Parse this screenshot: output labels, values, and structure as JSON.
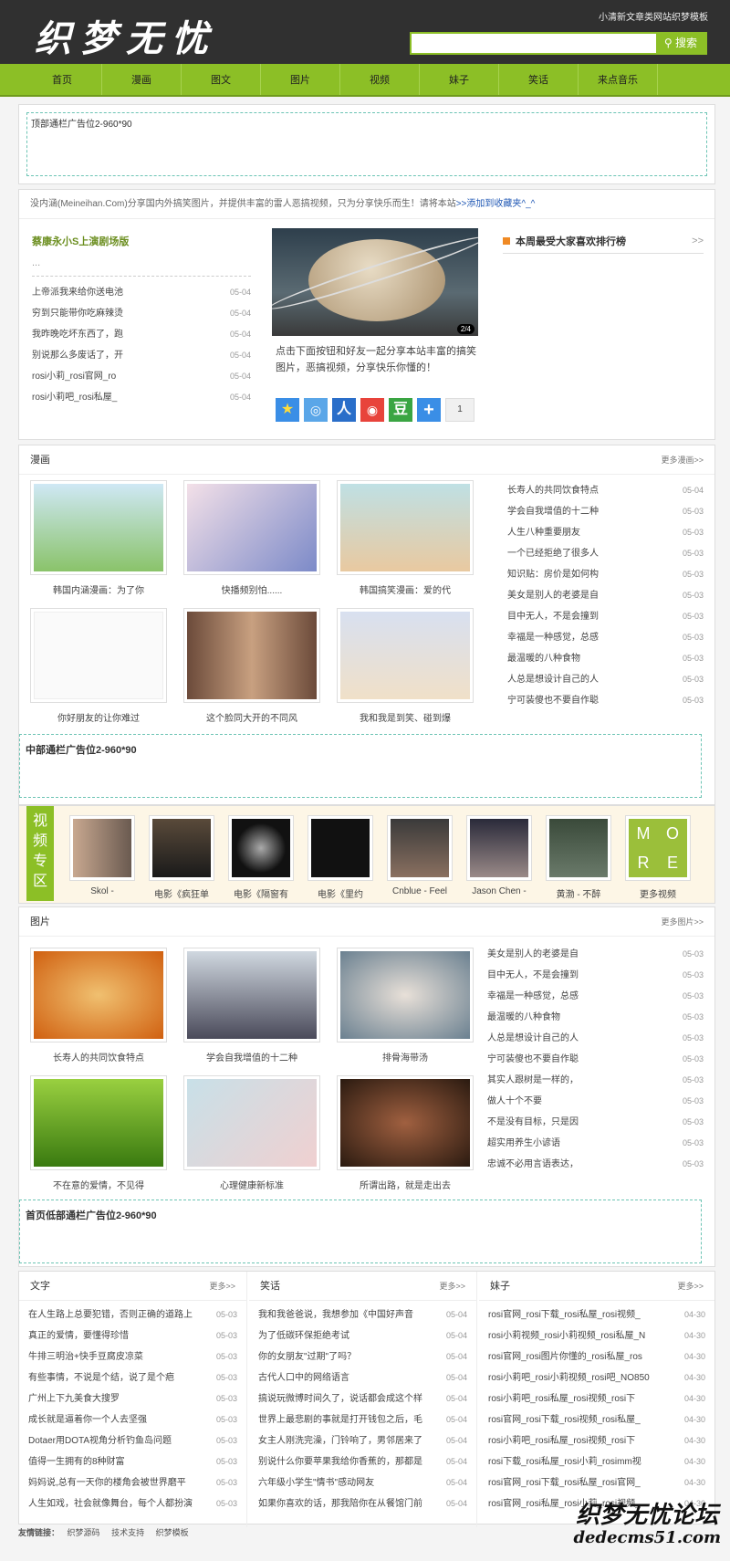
{
  "header": {
    "logo": "织梦无忧",
    "toplink": "小清新文章类网站织梦模板",
    "search_placeholder": "",
    "search_btn": "搜索"
  },
  "nav": [
    "首页",
    "漫画",
    "图文",
    "图片",
    "视频",
    "妹子",
    "笑话",
    "来点音乐"
  ],
  "ads": {
    "top": "顶部通栏广告位2-960*90",
    "middle": "中部通栏广告位2-960*90",
    "bottom": "首页低部通栏广告位2-960*90"
  },
  "notice": {
    "text": "没内涵(Meineihan.Com)分享国内外搞笑图片，并提供丰富的雷人恶搞视频，只为分享快乐而生！请将本站",
    "link": ">>添加到收藏夹^_^"
  },
  "headline": {
    "title": "蔡康永小S上演剧场版",
    "sub": "...",
    "items": [
      {
        "t": "上帝派我来给你送电池",
        "d": "05-04"
      },
      {
        "t": "穷到只能带你吃麻辣烫",
        "d": "05-04"
      },
      {
        "t": "我昨晚吃坏东西了，跑",
        "d": "05-04"
      },
      {
        "t": "别说那么多废话了，开",
        "d": "05-04"
      },
      {
        "t": "rosi小莉_rosi官网_ro",
        "d": "05-04"
      },
      {
        "t": "rosi小莉吧_rosi私屋_",
        "d": "05-04"
      }
    ]
  },
  "slider": {
    "counter": "2/4",
    "text": "点击下面按钮和好友一起分享本站丰富的搞笑图片，恶搞视频，分享快乐你懂的！",
    "share_count": "1"
  },
  "rank": {
    "title": "本周最受大家喜欢排行榜",
    "more": ">>"
  },
  "comics": {
    "title": "漫画",
    "more": "更多漫画>>",
    "thumbs": [
      "韩国内涵漫画：为了你",
      "快播频别怕......",
      "韩国搞笑漫画：爱的代",
      "你好朋友的让你难过",
      "这个脸同大开的不同风",
      "我和我是到笑、碰到爆"
    ],
    "list": [
      {
        "t": "长寿人的共同饮食特点",
        "d": "05-04"
      },
      {
        "t": "学会自我增值的十二种",
        "d": "05-03"
      },
      {
        "t": "人生八种重要朋友",
        "d": "05-03"
      },
      {
        "t": "一个已经拒绝了很多人",
        "d": "05-03"
      },
      {
        "t": "知识贴：房价是如何构",
        "d": "05-03"
      },
      {
        "t": "美女是别人的老婆是自",
        "d": "05-03"
      },
      {
        "t": "目中无人，不是会撞到",
        "d": "05-03"
      },
      {
        "t": "幸福是一种感觉，总感",
        "d": "05-03"
      },
      {
        "t": "最温暖的八种食物",
        "d": "05-03"
      },
      {
        "t": "人总是想设计自己的人",
        "d": "05-03"
      },
      {
        "t": "宁可装傻也不要自作聪",
        "d": "05-03"
      }
    ]
  },
  "video": {
    "label": "视频专区",
    "thumbs": [
      "Skol -",
      "电影《疯狂单",
      "电影《隔窗有",
      "电影《里约",
      "Cnblue - Feel",
      "Jason Chen -",
      "黄渤 - 不醉",
      "更多视频"
    ],
    "more_tile": [
      "M",
      "O",
      "R",
      "E"
    ]
  },
  "pics": {
    "title": "图片",
    "more": "更多图片>>",
    "thumbs": [
      "长寿人的共同饮食特点",
      "学会自我增值的十二种",
      "排骨海带汤",
      "不在意的爱情，不见得",
      "心理健康新标准",
      "所谓出路，就是走出去"
    ],
    "list": [
      {
        "t": "美女是别人的老婆是自",
        "d": "05-03"
      },
      {
        "t": "目中无人，不是会撞到",
        "d": "05-03"
      },
      {
        "t": "幸福是一种感觉，总感",
        "d": "05-03"
      },
      {
        "t": "最温暖的八种食物",
        "d": "05-03"
      },
      {
        "t": "人总是想设计自己的人",
        "d": "05-03"
      },
      {
        "t": "宁可装傻也不要自作聪",
        "d": "05-03"
      },
      {
        "t": "其实人跟树是一样的，",
        "d": "05-03"
      },
      {
        "t": "做人十个不要",
        "d": "05-03"
      },
      {
        "t": "不是没有目标，只是因",
        "d": "05-03"
      },
      {
        "t": "超实用养生小谚语",
        "d": "05-03"
      },
      {
        "t": "忠诚不必用言语表达，",
        "d": "05-03"
      }
    ]
  },
  "cols": [
    {
      "title": "文字",
      "more": "更多>>",
      "items": [
        {
          "t": "在人生路上总要犯错，否则正确的道路上",
          "d": "05-03"
        },
        {
          "t": "真正的爱情，要懂得珍惜",
          "d": "05-03"
        },
        {
          "t": "牛排三明治+快手豆腐皮凉菜",
          "d": "05-03"
        },
        {
          "t": "有些事情，不说是个结，说了是个疤",
          "d": "05-03"
        },
        {
          "t": "广州上下九美食大搜罗",
          "d": "05-03"
        },
        {
          "t": "成长就是逼着你一个人去坚强",
          "d": "05-03"
        },
        {
          "t": "Dotaer用DOTA视角分析钓鱼岛问题",
          "d": "05-03"
        },
        {
          "t": "值得一生拥有的8种财富",
          "d": "05-03"
        },
        {
          "t": "妈妈说,总有一天你的楼角会被世界磨平",
          "d": "05-03"
        },
        {
          "t": "人生如戏，社会就像舞台，每个人都扮演",
          "d": "05-03"
        }
      ]
    },
    {
      "title": "笑话",
      "more": "更多>>",
      "items": [
        {
          "t": "我和我爸爸说，我想参加《中国好声音",
          "d": "05-04"
        },
        {
          "t": "为了低碳环保拒绝考试",
          "d": "05-04"
        },
        {
          "t": "你的女朋友\"过期\"了吗？",
          "d": "05-04"
        },
        {
          "t": "古代人口中的网络语言",
          "d": "05-04"
        },
        {
          "t": "搞说玩微博时间久了，说话都会成这个样",
          "d": "05-04"
        },
        {
          "t": "世界上最悲剧的事就是打开钱包之后，毛",
          "d": "05-04"
        },
        {
          "t": "女主人刚洗完澡，门铃响了，男邻居来了",
          "d": "05-04"
        },
        {
          "t": "别说什么你要苹果我给你香蕉的，那都是",
          "d": "05-04"
        },
        {
          "t": "六年级小学生\"情书\"感动网友",
          "d": "05-04"
        },
        {
          "t": "如果你喜欢的话，那我陪你在从餐馆门前",
          "d": "05-04"
        }
      ]
    },
    {
      "title": "妹子",
      "more": "更多>>",
      "items": [
        {
          "t": "rosi官网_rosi下载_rosi私屋_rosi视频_",
          "d": "04-30"
        },
        {
          "t": "rosi小莉视频_rosi小莉视频_rosi私屋_N",
          "d": "04-30"
        },
        {
          "t": "rosi官网_rosi图片你懂的_rosi私屋_ros",
          "d": "04-30"
        },
        {
          "t": "rosi小莉吧_rosi小莉视频_rosi吧_NO850",
          "d": "04-30"
        },
        {
          "t": "rosi小莉吧_rosi私屋_rosi视频_rosi下",
          "d": "04-30"
        },
        {
          "t": "rosi官网_rosi下载_rosi视频_rosi私屋_",
          "d": "04-30"
        },
        {
          "t": "rosi小莉吧_rosi私屋_rosi视频_rosi下",
          "d": "04-30"
        },
        {
          "t": "rosi下载_rosi私屋_rosi小莉_rosimm视",
          "d": "04-30"
        },
        {
          "t": "rosi官网_rosi下载_rosi私屋_rosi官网_",
          "d": "04-30"
        },
        {
          "t": "rosi官网_rosi私屋_rosi小莉_rosi视频_",
          "d": "04-30"
        }
      ]
    }
  ],
  "footer": {
    "label": "友情链接：",
    "links": [
      "织梦源码",
      "技术支持",
      "织梦模板"
    ]
  },
  "watermark": {
    "line1": "织梦无忧论坛",
    "line2": "dedecms51.com"
  }
}
